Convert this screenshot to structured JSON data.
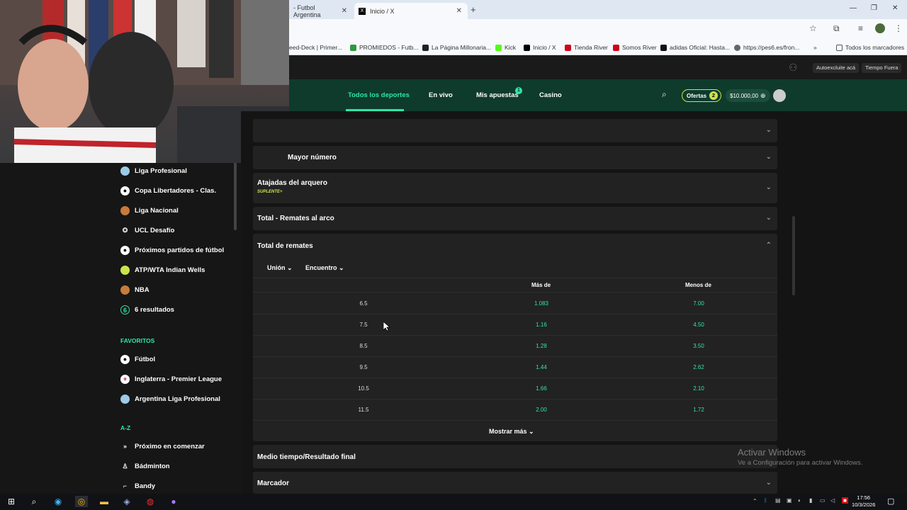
{
  "browser": {
    "tabs": [
      {
        "title": "- Futbol Argentina"
      },
      {
        "title": "Inicio / X"
      }
    ],
    "new_tab": "+",
    "window_controls": [
      "—",
      "❐",
      "✕"
    ],
    "bookmarks": [
      {
        "label": "eed-Deck | Primer...",
        "color": "#888888"
      },
      {
        "label": "PROMIEDOS - Futb...",
        "color": "#2b9a3e"
      },
      {
        "label": "La Página Millonaria...",
        "color": "#222222"
      },
      {
        "label": "Kick",
        "color": "#53fc18"
      },
      {
        "label": "Inicio / X",
        "color": "#000000"
      },
      {
        "label": "Tienda River",
        "color": "#d0021b"
      },
      {
        "label": "Somos River",
        "color": "#d0021b"
      },
      {
        "label": "adidas Oficial: Hasta...",
        "color": "#111111"
      },
      {
        "label": "https://pes6.es/fron...",
        "color": "#666666"
      }
    ],
    "bookmarks_more": "»",
    "all_bookmarks": "Todos los marcadores"
  },
  "site": {
    "top_pills": [
      "Autoexcluite acá",
      "Tiempo Fuera"
    ],
    "nav": {
      "all_sports": "Todos los deportes",
      "live": "En vivo",
      "my_bets": "Mis apuestas",
      "my_bets_badge": "1",
      "casino": "Casino"
    },
    "ofertas_label": "Ofertas",
    "ofertas_count": "2",
    "balance": "$10.000,00"
  },
  "sidebar": {
    "items_top": [
      {
        "label": "Liga Profesional",
        "icon": "argentina-flag-icon"
      },
      {
        "label": "Copa Libertadores - Clas.",
        "icon": "soccer-ball-icon"
      },
      {
        "label": "Liga Nacional",
        "icon": "basketball-icon"
      },
      {
        "label": "UCL Desafío",
        "icon": "ucl-icon"
      },
      {
        "label": "Próximos partidos de fútbol",
        "icon": "soccer-ball-icon"
      },
      {
        "label": "ATP/WTA Indian Wells",
        "icon": "tennis-ball-icon"
      },
      {
        "label": "NBA",
        "icon": "basketball-icon"
      },
      {
        "label": "6 resultados",
        "icon": "number-six-icon"
      }
    ],
    "favoritos_header": "FAVORITOS",
    "favoritos": [
      {
        "label": "Fútbol",
        "icon": "soccer-ball-icon"
      },
      {
        "label": "Inglaterra - Premier League",
        "icon": "england-flag-icon"
      },
      {
        "label": "Argentina Liga Profesional",
        "icon": "argentina-flag-icon"
      }
    ],
    "az_header": "A-Z",
    "az": [
      {
        "label": "Próximo en comenzar",
        "icon": "next-arrow-icon"
      },
      {
        "label": "Bádminton",
        "icon": "shuttlecock-icon"
      },
      {
        "label": "Bandy",
        "icon": "bandy-icon"
      }
    ]
  },
  "markets": {
    "mayor_numero": "Mayor número",
    "atajadas": "Atajadas del arquero",
    "atajadas_tag": "SUPLENTE+",
    "total_remates_arco": "Total - Remates al arco",
    "total_remates": "Total de remates",
    "filter_union": "Unión",
    "filter_encuentro": "Encuentro",
    "col_mas": "Más de",
    "col_menos": "Menos de",
    "rows": [
      {
        "line": "6.5",
        "over": "1.083",
        "under": "7.00"
      },
      {
        "line": "7.5",
        "over": "1.16",
        "under": "4.50"
      },
      {
        "line": "8.5",
        "over": "1.28",
        "under": "3.50"
      },
      {
        "line": "9.5",
        "over": "1.44",
        "under": "2.62"
      },
      {
        "line": "10.5",
        "over": "1.66",
        "under": "2.10"
      },
      {
        "line": "11.5",
        "over": "2.00",
        "under": "1.72"
      }
    ],
    "mostrar_mas": "Mostrar más",
    "medio_tiempo": "Medio tiempo/Resultado final",
    "marcador": "Marcador"
  },
  "watermark": {
    "line1": "Activar Windows",
    "line2": "Ve a Configuración para activar Windows."
  },
  "taskbar": {
    "time": "17:56",
    "date": "10/3/2026"
  }
}
